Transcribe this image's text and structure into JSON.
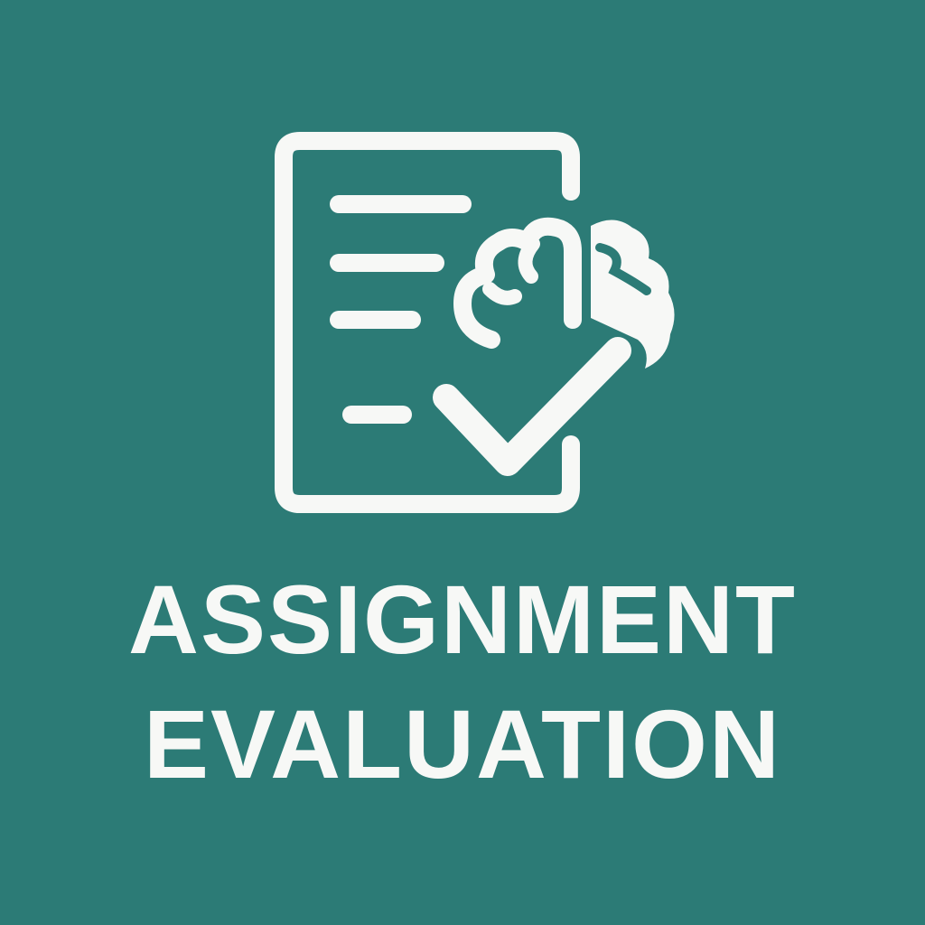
{
  "app": {
    "background_color": "#2C7B76",
    "foreground_color": "#F7F8F6"
  },
  "icon": {
    "name": "assignment-evaluation-icon",
    "parts": [
      "document-icon",
      "brain-icon",
      "checkmark-icon"
    ]
  },
  "title": {
    "line1": "ASSIGNMENT",
    "line2": "EVALUATION"
  }
}
